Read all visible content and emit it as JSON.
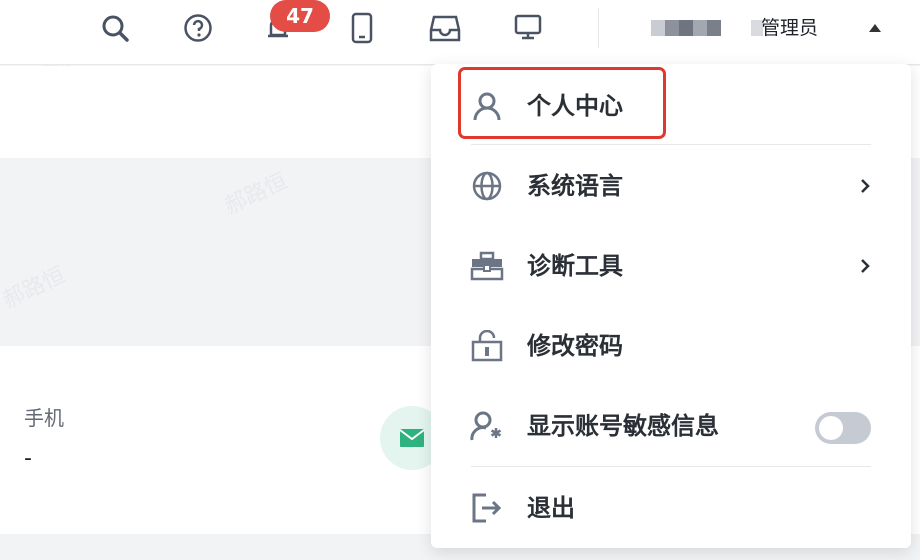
{
  "topbar": {
    "icons": [
      "search-icon",
      "help-icon",
      "bell-icon",
      "mobile-icon",
      "inbox-icon",
      "monitor-icon"
    ],
    "notification_count": "47",
    "user_name": "管理员"
  },
  "contact": {
    "phone_label": "手机",
    "phone_value": "-"
  },
  "menu": {
    "items": [
      {
        "label": "个人中心",
        "icon": "user-icon"
      },
      {
        "label": "系统语言",
        "icon": "globe-icon"
      },
      {
        "label": "诊断工具",
        "icon": "toolbox-icon"
      },
      {
        "label": "修改密码",
        "icon": "unlock-icon"
      },
      {
        "label": "显示账号敏感信息",
        "icon": "user-asterisk-icon",
        "toggle_on": false
      },
      {
        "label": "退出",
        "icon": "logout-icon"
      }
    ]
  },
  "watermark_text": "郝路恒",
  "colors": {
    "badge": "#e34d45",
    "highlight": "#e0382d",
    "mail_accent": "#2fb27d"
  }
}
